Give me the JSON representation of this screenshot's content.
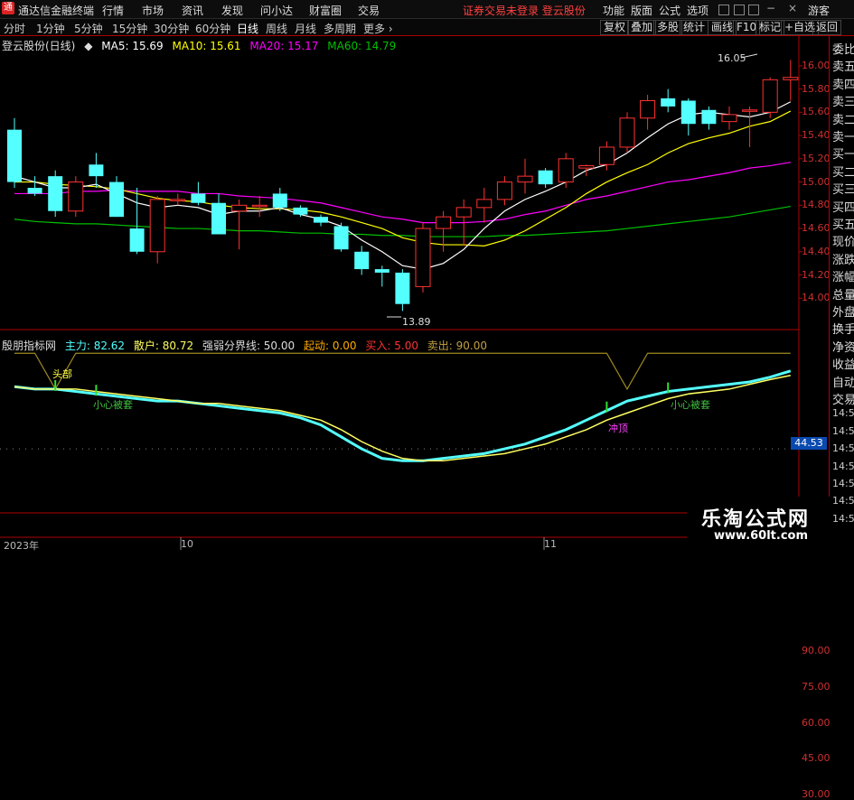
{
  "titlebar": {
    "app_title": "通达信金融终端",
    "menus": [
      "行情",
      "市场",
      "资讯",
      "发现",
      "问小达",
      "财富圈",
      "交易"
    ],
    "status": "证券交易未登录",
    "stock_name": "登云股份",
    "right_menus": [
      "功能",
      "版面",
      "公式",
      "选项"
    ],
    "user": "游客"
  },
  "periods": [
    "分时",
    "1分钟",
    "5分钟",
    "15分钟",
    "30分钟",
    "60分钟",
    "日线",
    "周线",
    "月线",
    "多周期",
    "更多"
  ],
  "active_period": "日线",
  "tools": [
    "复权",
    "叠加",
    "多股",
    "统计",
    "画线",
    "F10",
    "标记",
    "+自选",
    "返回"
  ],
  "kline_header": {
    "title": "登云股份(日线)",
    "ma5": "MA5: 15.69",
    "ma10": "MA10: 15.61",
    "ma20": "MA20: 15.17",
    "ma60": "MA60: 14.79"
  },
  "ind_header": {
    "name": "殷朋指标网",
    "main": "主力: 82.62",
    "retail": "散户: 80.72",
    "line": "强弱分界线: 50.00",
    "start": "起动: 0.00",
    "buy": "买入: 5.00",
    "sell": "卖出: 90.00"
  },
  "annotations": {
    "high": "16.05",
    "low": "13.89",
    "top_label": "头部",
    "careful1": "小心被套",
    "careful2": "小心被套",
    "wash": "冲顶",
    "current_value": "44.53"
  },
  "right_panel": [
    "委比",
    "卖五",
    "卖四",
    "卖三",
    "卖二",
    "卖一",
    "买一",
    "买二",
    "买三",
    "买四",
    "买五",
    "现价",
    "涨跌",
    "涨幅",
    "总量",
    "外盘",
    "换手",
    "净资",
    "收益",
    "自动",
    "交易",
    "14:55",
    "14:56",
    "14:56",
    "14:56",
    "14:56",
    "14:56",
    "14:56"
  ],
  "price_ticks": [
    "16.00",
    "15.80",
    "15.60",
    "15.40",
    "15.20",
    "15.00",
    "14.80",
    "14.60",
    "14.40",
    "14.20",
    "14.00"
  ],
  "ind_ticks": [
    "90.00",
    "75.00",
    "60.00",
    "45.00",
    "30.00"
  ],
  "x_labels": [
    "2023年",
    "10",
    "11"
  ],
  "watermark": {
    "line1": "乐淘公式网",
    "line2": "www.60lt.com"
  },
  "colors": {
    "up": "#ff3232",
    "down": "#54ffff",
    "ma5": "#ffffff",
    "ma10": "#ffff00",
    "ma20": "#ff00ff",
    "ma60": "#00c000"
  },
  "chart_data": {
    "type": "candlestick",
    "price_range": [
      13.8,
      16.1
    ],
    "candles": [
      {
        "o": 15.45,
        "h": 15.55,
        "l": 14.95,
        "c": 15.0
      },
      {
        "o": 14.95,
        "h": 15.05,
        "l": 14.88,
        "c": 14.9
      },
      {
        "o": 15.05,
        "h": 15.1,
        "l": 14.7,
        "c": 14.75
      },
      {
        "o": 14.75,
        "h": 15.05,
        "l": 14.7,
        "c": 15.0
      },
      {
        "o": 15.15,
        "h": 15.25,
        "l": 14.95,
        "c": 15.05
      },
      {
        "o": 15.0,
        "h": 15.05,
        "l": 14.7,
        "c": 14.7
      },
      {
        "o": 14.6,
        "h": 14.95,
        "l": 14.38,
        "c": 14.4
      },
      {
        "o": 14.4,
        "h": 14.88,
        "l": 14.3,
        "c": 14.85
      },
      {
        "o": 14.85,
        "h": 14.9,
        "l": 14.8,
        "c": 14.85
      },
      {
        "o": 14.9,
        "h": 15.0,
        "l": 14.8,
        "c": 14.82
      },
      {
        "o": 14.82,
        "h": 14.9,
        "l": 14.55,
        "c": 14.55
      },
      {
        "o": 14.75,
        "h": 14.85,
        "l": 14.42,
        "c": 14.8
      },
      {
        "o": 14.8,
        "h": 14.88,
        "l": 14.7,
        "c": 14.8
      },
      {
        "o": 14.9,
        "h": 14.95,
        "l": 14.75,
        "c": 14.78
      },
      {
        "o": 14.78,
        "h": 14.8,
        "l": 14.7,
        "c": 14.72
      },
      {
        "o": 14.7,
        "h": 14.72,
        "l": 14.62,
        "c": 14.65
      },
      {
        "o": 14.62,
        "h": 14.65,
        "l": 14.4,
        "c": 14.42
      },
      {
        "o": 14.4,
        "h": 14.45,
        "l": 14.2,
        "c": 14.25
      },
      {
        "o": 14.25,
        "h": 14.28,
        "l": 14.1,
        "c": 14.22
      },
      {
        "o": 14.22,
        "h": 14.25,
        "l": 13.89,
        "c": 13.95
      },
      {
        "o": 14.1,
        "h": 14.65,
        "l": 14.05,
        "c": 14.6
      },
      {
        "o": 14.6,
        "h": 14.75,
        "l": 14.4,
        "c": 14.7
      },
      {
        "o": 14.7,
        "h": 14.85,
        "l": 14.45,
        "c": 14.78
      },
      {
        "o": 14.78,
        "h": 14.95,
        "l": 14.65,
        "c": 14.85
      },
      {
        "o": 14.85,
        "h": 15.05,
        "l": 14.8,
        "c": 15.0
      },
      {
        "o": 15.0,
        "h": 15.2,
        "l": 14.9,
        "c": 15.05
      },
      {
        "o": 15.1,
        "h": 15.12,
        "l": 14.95,
        "c": 14.98
      },
      {
        "o": 15.0,
        "h": 15.25,
        "l": 14.95,
        "c": 15.2
      },
      {
        "o": 15.12,
        "h": 15.15,
        "l": 15.05,
        "c": 15.14
      },
      {
        "o": 15.15,
        "h": 15.35,
        "l": 15.1,
        "c": 15.3
      },
      {
        "o": 15.3,
        "h": 15.6,
        "l": 15.25,
        "c": 15.55
      },
      {
        "o": 15.55,
        "h": 15.75,
        "l": 15.45,
        "c": 15.7
      },
      {
        "o": 15.72,
        "h": 15.8,
        "l": 15.6,
        "c": 15.65
      },
      {
        "o": 15.7,
        "h": 15.72,
        "l": 15.4,
        "c": 15.5
      },
      {
        "o": 15.62,
        "h": 15.65,
        "l": 15.45,
        "c": 15.5
      },
      {
        "o": 15.52,
        "h": 15.65,
        "l": 15.45,
        "c": 15.58
      },
      {
        "o": 15.62,
        "h": 15.65,
        "l": 15.3,
        "c": 15.62
      },
      {
        "o": 15.6,
        "h": 15.9,
        "l": 15.55,
        "c": 15.88
      },
      {
        "o": 15.88,
        "h": 16.05,
        "l": 15.7,
        "c": 15.9
      }
    ],
    "ma5": [
      15.05,
      15.0,
      14.95,
      14.95,
      14.98,
      14.9,
      14.82,
      14.78,
      14.8,
      14.78,
      14.72,
      14.75,
      14.75,
      14.78,
      14.72,
      14.68,
      14.62,
      14.5,
      14.4,
      14.28,
      14.25,
      14.3,
      14.42,
      14.6,
      14.75,
      14.85,
      14.92,
      15.0,
      15.1,
      15.15,
      15.25,
      15.38,
      15.5,
      15.58,
      15.6,
      15.58,
      15.56,
      15.6,
      15.69
    ],
    "ma10": [
      15.0,
      15.0,
      14.98,
      14.97,
      14.96,
      14.94,
      14.9,
      14.86,
      14.84,
      14.83,
      14.8,
      14.78,
      14.77,
      14.77,
      14.76,
      14.74,
      14.7,
      14.65,
      14.6,
      14.52,
      14.48,
      14.46,
      14.46,
      14.45,
      14.5,
      14.58,
      14.68,
      14.78,
      14.9,
      15.0,
      15.08,
      15.15,
      15.25,
      15.33,
      15.38,
      15.42,
      15.48,
      15.52,
      15.61
    ],
    "ma20": [
      14.9,
      14.9,
      14.9,
      14.92,
      14.92,
      14.93,
      14.92,
      14.92,
      14.92,
      14.9,
      14.9,
      14.88,
      14.87,
      14.86,
      14.84,
      14.82,
      14.78,
      14.74,
      14.7,
      14.68,
      14.65,
      14.65,
      14.65,
      14.66,
      14.68,
      14.72,
      14.75,
      14.8,
      14.85,
      14.88,
      14.92,
      14.96,
      15.0,
      15.02,
      15.05,
      15.08,
      15.12,
      15.14,
      15.17
    ],
    "ma60": [
      14.68,
      14.66,
      14.65,
      14.64,
      14.64,
      14.63,
      14.62,
      14.61,
      14.6,
      14.6,
      14.59,
      14.58,
      14.58,
      14.57,
      14.56,
      14.56,
      14.55,
      14.55,
      14.54,
      14.54,
      14.53,
      14.53,
      14.53,
      14.53,
      14.54,
      14.54,
      14.55,
      14.56,
      14.57,
      14.58,
      14.6,
      14.62,
      14.64,
      14.66,
      14.68,
      14.7,
      14.73,
      14.76,
      14.79
    ],
    "indicator": {
      "range": [
        30,
        95
      ],
      "main": [
        76,
        75,
        75,
        74,
        73,
        72,
        71,
        70,
        70,
        69,
        68,
        67,
        66,
        65,
        63,
        60,
        55,
        50,
        46,
        45,
        45,
        46,
        47,
        48,
        50,
        52,
        55,
        58,
        62,
        66,
        70,
        72,
        74,
        75,
        76,
        77,
        78,
        80,
        82.62
      ],
      "retail": [
        76,
        75,
        75,
        75,
        74,
        73,
        72,
        71,
        70,
        69,
        69,
        68,
        67,
        66,
        64,
        62,
        58,
        53,
        49,
        46,
        45,
        45,
        46,
        47,
        48,
        50,
        52,
        55,
        58,
        62,
        65,
        68,
        71,
        73,
        74,
        75,
        77,
        79,
        80.72
      ],
      "signal": [
        90,
        90,
        75,
        90,
        90,
        90,
        90,
        90,
        90,
        90,
        90,
        90,
        90,
        90,
        90,
        90,
        90,
        90,
        90,
        90,
        90,
        90,
        90,
        90,
        90,
        90,
        90,
        90,
        90,
        90,
        75,
        90,
        90,
        90,
        90,
        90,
        90,
        90,
        90
      ]
    }
  }
}
